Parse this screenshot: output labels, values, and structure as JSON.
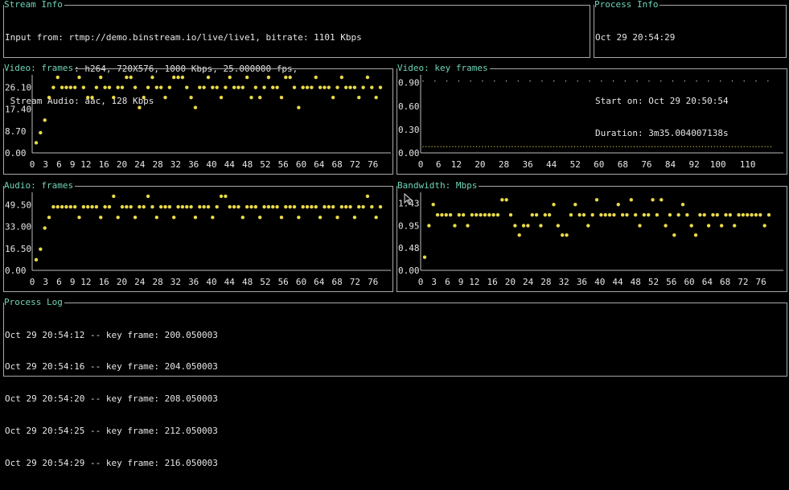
{
  "stream_info": {
    "title": "Stream Info",
    "lines": [
      "Input from: rtmp://demo.binstream.io/live/live1, bitrate: 1101 Kbps",
      " Stream Video: h264, 720X576, 1000 Kbps, 25.000000 fps,",
      " Stream Audio: aac, 128 Kbps"
    ]
  },
  "process_info": {
    "title": "Process Info",
    "lines": [
      "Oct 29 20:54:29",
      "",
      "Start on: Oct 29 20:50:54",
      "Duration: 3m35.004007138s"
    ]
  },
  "process_log": {
    "title": "Process Log",
    "lines": [
      "Oct 29 20:54:12 -- key frame: 200.050003",
      "Oct 29 20:54:16 -- key frame: 204.050003",
      "Oct 29 20:54:20 -- key frame: 208.050003",
      "Oct 29 20:54:25 -- key frame: 212.050003",
      "Oct 29 20:54:29 -- key frame: 216.050003"
    ]
  },
  "colors": {
    "dot": "#e8d949",
    "axis": "#bdbdbd",
    "title": "#6fd3b7",
    "border": "#a8a8a8"
  },
  "chart_data": [
    {
      "id": "video_frames",
      "type": "scatter",
      "title": "Video: frames",
      "ylim": [
        0,
        31
      ],
      "xlim": [
        0,
        80
      ],
      "y_ticks": [
        "26.10",
        "17.40",
        "8.70",
        "0.00"
      ],
      "y_tick_values": [
        26.1,
        17.4,
        8.7,
        0
      ],
      "x_ticks": [
        "0",
        "3",
        "6",
        "9",
        "12",
        "16",
        "20",
        "24",
        "28",
        "32",
        "36",
        "40",
        "44",
        "48",
        "52",
        "56",
        "60",
        "64",
        "68",
        "72",
        "76"
      ],
      "x_tick_values": [
        0,
        3,
        6,
        9,
        12,
        16,
        20,
        24,
        28,
        32,
        36,
        40,
        44,
        48,
        52,
        56,
        60,
        64,
        68,
        72,
        76
      ],
      "y": [
        4,
        8,
        13,
        22,
        26,
        30,
        26,
        26,
        26,
        26,
        30,
        26,
        22,
        22,
        26,
        30,
        26,
        26,
        22,
        26,
        26,
        30,
        30,
        26,
        18,
        22,
        26,
        30,
        26,
        26,
        22,
        26,
        30,
        30,
        30,
        26,
        22,
        18,
        26,
        26,
        30,
        26,
        26,
        22,
        26,
        30,
        26,
        26,
        26,
        30,
        22,
        26,
        22,
        26,
        30,
        26,
        26,
        22,
        30,
        30,
        26,
        18,
        26,
        26,
        26,
        30,
        26,
        26,
        26,
        22,
        26,
        30,
        26,
        26,
        26,
        22,
        26,
        30,
        26,
        22,
        26
      ]
    },
    {
      "id": "video_key_frames",
      "type": "scatter",
      "title": "Video: key frames",
      "ylim": [
        0,
        1.0
      ],
      "xlim": [
        0,
        122
      ],
      "y_ticks": [
        "0.90",
        "0.60",
        "0.30",
        "0.00"
      ],
      "y_tick_values": [
        0.9,
        0.6,
        0.3,
        0
      ],
      "x_ticks": [
        "0",
        "6",
        "12",
        "20",
        "28",
        "36",
        "44",
        "52",
        "60",
        "68",
        "76",
        "84",
        "92",
        "100",
        "110"
      ],
      "x_tick_values": [
        0,
        6,
        12,
        20,
        28,
        36,
        44,
        52,
        60,
        68,
        76,
        84,
        92,
        100,
        110
      ],
      "key_x": [
        0,
        4,
        8,
        12,
        16,
        20,
        24,
        28,
        32,
        36,
        40,
        44,
        48,
        52,
        56,
        60,
        64,
        68,
        72,
        76,
        80,
        84,
        88,
        92,
        96,
        100,
        104,
        108,
        112,
        116
      ],
      "key_y": 0.92,
      "base_y": 0.08,
      "base_x_range": [
        0,
        117
      ]
    },
    {
      "id": "audio_frames",
      "type": "scatter",
      "title": "Audio: frames",
      "ylim": [
        0,
        59
      ],
      "xlim": [
        0,
        80
      ],
      "y_ticks": [
        "49.50",
        "33.00",
        "16.50",
        "0.00"
      ],
      "y_tick_values": [
        49.5,
        33,
        16.5,
        0
      ],
      "x_ticks": [
        "0",
        "3",
        "6",
        "9",
        "12",
        "16",
        "20",
        "24",
        "28",
        "32",
        "36",
        "40",
        "44",
        "48",
        "52",
        "56",
        "60",
        "64",
        "68",
        "72",
        "76"
      ],
      "x_tick_values": [
        0,
        3,
        6,
        9,
        12,
        16,
        20,
        24,
        28,
        32,
        36,
        40,
        44,
        48,
        52,
        56,
        60,
        64,
        68,
        72,
        76
      ],
      "y": [
        8,
        16,
        32,
        40,
        48,
        48,
        48,
        48,
        48,
        48,
        40,
        48,
        48,
        48,
        48,
        40,
        48,
        48,
        56,
        40,
        48,
        48,
        48,
        40,
        48,
        48,
        56,
        48,
        40,
        48,
        48,
        48,
        40,
        48,
        48,
        48,
        48,
        40,
        48,
        48,
        48,
        40,
        48,
        56,
        56,
        48,
        48,
        48,
        40,
        48,
        48,
        48,
        40,
        48,
        48,
        48,
        48,
        40,
        48,
        48,
        48,
        40,
        48,
        48,
        48,
        48,
        40,
        48,
        48,
        48,
        40,
        48,
        48,
        48,
        40,
        48,
        48,
        56,
        48,
        40,
        48
      ]
    },
    {
      "id": "bandwidth",
      "type": "scatter",
      "title": "Bandwidth: Mbps",
      "ylim": [
        0,
        1.66
      ],
      "xlim": [
        0,
        81
      ],
      "y_ticks": [
        "1.43",
        "0.95",
        "0.48",
        "0.00"
      ],
      "y_tick_values": [
        1.43,
        0.95,
        0.48,
        0
      ],
      "x_ticks": [
        "0",
        "3",
        "6",
        "9",
        "12",
        "16",
        "20",
        "24",
        "28",
        "32",
        "36",
        "40",
        "44",
        "48",
        "52",
        "56",
        "60",
        "64",
        "68",
        "72",
        "76"
      ],
      "x_tick_values": [
        0,
        3,
        6,
        9,
        12,
        16,
        20,
        24,
        28,
        32,
        36,
        40,
        44,
        48,
        52,
        56,
        60,
        64,
        68,
        72,
        76
      ],
      "y": [
        0.28,
        0.95,
        1.4,
        1.18,
        1.18,
        1.18,
        1.18,
        0.95,
        1.18,
        1.18,
        0.95,
        1.18,
        1.18,
        1.18,
        1.18,
        1.18,
        1.18,
        1.18,
        1.5,
        1.5,
        1.18,
        0.95,
        0.75,
        0.95,
        0.95,
        1.18,
        1.18,
        0.95,
        1.18,
        1.18,
        1.4,
        0.95,
        0.75,
        0.75,
        1.18,
        1.4,
        1.18,
        1.18,
        0.95,
        1.18,
        1.5,
        1.18,
        1.18,
        1.18,
        1.18,
        1.4,
        1.18,
        1.18,
        1.5,
        1.18,
        0.95,
        1.18,
        1.18,
        1.5,
        1.18,
        1.5,
        0.95,
        1.18,
        0.75,
        1.18,
        1.4,
        1.18,
        0.95,
        0.75,
        1.18,
        1.18,
        0.95,
        1.18,
        1.18,
        0.95,
        1.18,
        1.18,
        0.95,
        1.18,
        1.18,
        1.18,
        1.18,
        1.18,
        1.18,
        0.95,
        1.18
      ]
    }
  ]
}
